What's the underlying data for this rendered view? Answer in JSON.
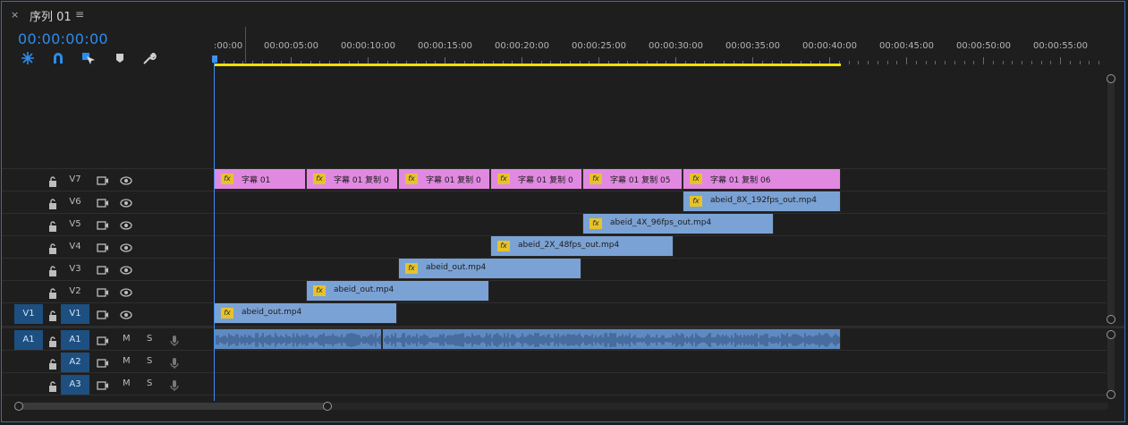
{
  "panel": {
    "close_label": "×",
    "title": "序列 01",
    "menu_label": "≡",
    "timecode": "00:00:00:00"
  },
  "toolbar": {
    "icons": [
      "snap-insert-icon",
      "snap-magnet-icon",
      "linked-selection-icon",
      "add-marker-icon",
      "settings-wrench-icon"
    ]
  },
  "ruler": {
    "labels": [
      ":00:00",
      "00:00:05:00",
      "00:00:10:00",
      "00:00:15:00",
      "00:00:20:00",
      "00:00:25:00",
      "00:00:30:00",
      "00:00:35:00",
      "00:00:40:00",
      "00:00:45:00",
      "00:00:50:00",
      "00:00:55:00"
    ]
  },
  "video_tracks": [
    {
      "name": "V7",
      "source": ""
    },
    {
      "name": "V6",
      "source": ""
    },
    {
      "name": "V5",
      "source": ""
    },
    {
      "name": "V4",
      "source": ""
    },
    {
      "name": "V3",
      "source": ""
    },
    {
      "name": "V2",
      "source": ""
    },
    {
      "name": "V1",
      "source": "V1"
    }
  ],
  "audio_tracks": [
    {
      "name": "A1",
      "source": "A1",
      "m": "M",
      "s": "S"
    },
    {
      "name": "A2",
      "source": "",
      "m": "M",
      "s": "S"
    },
    {
      "name": "A3",
      "source": "",
      "m": "M",
      "s": "S"
    }
  ],
  "clips": {
    "fx_label": "fx",
    "v7": [
      "字幕 01",
      "字幕 01 复制 0",
      "字幕 01 复制 0",
      "字幕 01 复制 0",
      "字幕 01 复制 05",
      "字幕 01 复制 06"
    ],
    "v6": "abeid_8X_192fps_out.mp4",
    "v5": "abeid_4X_96fps_out.mp4",
    "v4": "abeid_2X_48fps_out.mp4",
    "v3": "abeid_out.mp4",
    "v2": "abeid_out.mp4",
    "v1": "abeid_out.mp4"
  },
  "colors": {
    "accent": "#2d8ceb",
    "graphic_clip": "#e189e1",
    "video_clip": "#7ba2d4",
    "audio_clip": "#5f8ac2",
    "work_area": "#f0e000"
  }
}
